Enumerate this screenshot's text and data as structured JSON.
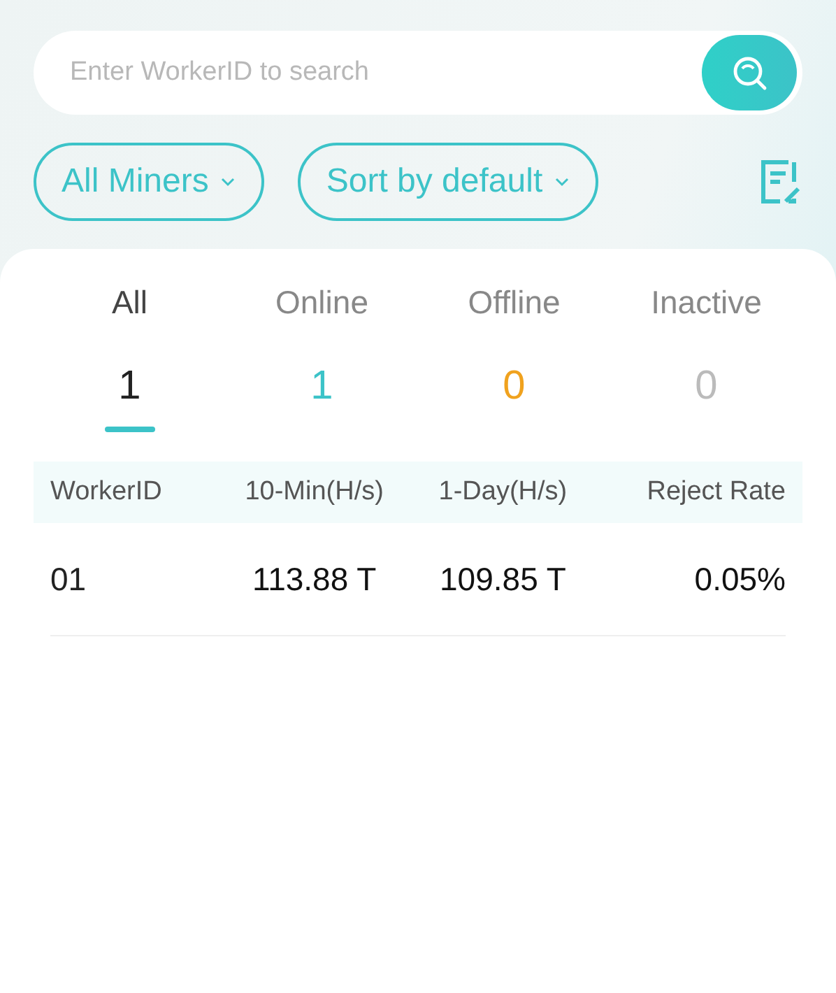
{
  "search": {
    "placeholder": "Enter WorkerID to search"
  },
  "filters": [
    {
      "label": "All Miners"
    },
    {
      "label": "Sort by default"
    }
  ],
  "tabs": [
    {
      "label": "All",
      "count": "1",
      "color": "#222222",
      "selected": true
    },
    {
      "label": "Online",
      "count": "1",
      "color": "#3cc3c8",
      "selected": false
    },
    {
      "label": "Offline",
      "count": "0",
      "color": "#f0a21e",
      "selected": false
    },
    {
      "label": "Inactive",
      "count": "0",
      "color": "#bbbbbb",
      "selected": false
    }
  ],
  "table": {
    "columns": [
      "WorkerID",
      "10-Min(H/s)",
      "1-Day(H/s)",
      "Reject Rate"
    ],
    "rows": [
      [
        "01",
        "113.88 T",
        "109.85 T",
        "0.05%"
      ]
    ]
  }
}
